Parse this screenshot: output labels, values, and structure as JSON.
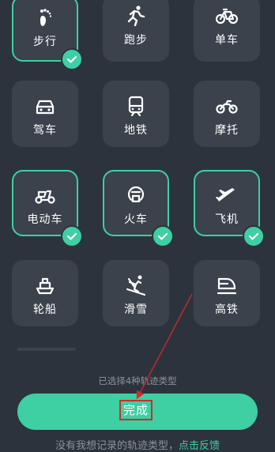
{
  "tiles": [
    {
      "label": "步行",
      "icon": "footprints-icon",
      "selected": true
    },
    {
      "label": "跑步",
      "icon": "running-icon",
      "selected": false
    },
    {
      "label": "单车",
      "icon": "bicycle-icon",
      "selected": false
    },
    {
      "label": "驾车",
      "icon": "car-icon",
      "selected": false
    },
    {
      "label": "地铁",
      "icon": "subway-icon",
      "selected": false
    },
    {
      "label": "摩托",
      "icon": "motorcycle-icon",
      "selected": false
    },
    {
      "label": "电动车",
      "icon": "scooter-icon",
      "selected": true
    },
    {
      "label": "火车",
      "icon": "train-icon",
      "selected": true
    },
    {
      "label": "飞机",
      "icon": "airplane-icon",
      "selected": true
    },
    {
      "label": "轮船",
      "icon": "ship-icon",
      "selected": false
    },
    {
      "label": "滑雪",
      "icon": "skiing-icon",
      "selected": false
    },
    {
      "label": "高铁",
      "icon": "high-speed-rail-icon",
      "selected": false
    }
  ],
  "status_text": "已选择4种轨迹类型",
  "done_button": "完成",
  "footer": {
    "text": "没有我想记录的轨迹类型，",
    "link": "点击反馈"
  },
  "colors": {
    "accent": "#3ecfa3",
    "background": "#2d333d",
    "tile": "#3b424c",
    "annotation": "#d42a2a"
  }
}
